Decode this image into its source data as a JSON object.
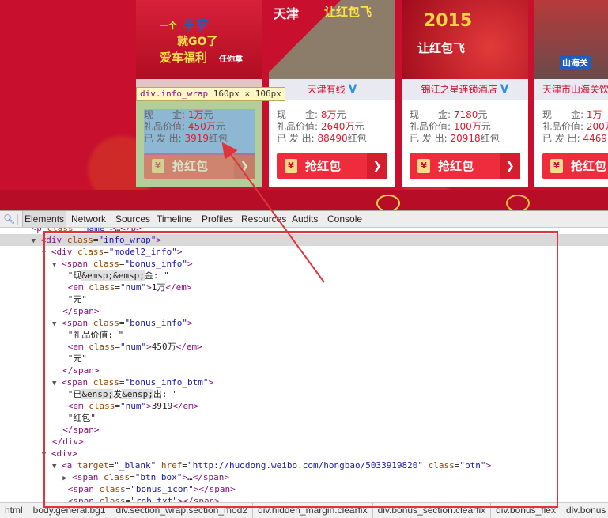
{
  "cards": [
    {
      "id": "card1",
      "banner_lines": [
        "一个",
        "车享",
        "就GO了",
        "爱车福利",
        "任你拿"
      ],
      "name": "",
      "verified": false,
      "rows": [
        {
          "label": "现　　金: ",
          "num": "1万",
          "unit": "元"
        },
        {
          "label": "礼品价值: ",
          "num": "450万",
          "unit": "元"
        },
        {
          "label": "已 发 出: ",
          "num": "3919",
          "unit": "红包"
        }
      ],
      "button": "抢红包"
    },
    {
      "id": "card2",
      "banner_lines": [
        "天津",
        "让红包飞"
      ],
      "name": "天津有线",
      "verified": true,
      "rows": [
        {
          "label": "现　　金: ",
          "num": "8万",
          "unit": "元"
        },
        {
          "label": "礼品价值: ",
          "num": "2640万",
          "unit": "元"
        },
        {
          "label": "已 发 出: ",
          "num": "88490",
          "unit": "红包"
        }
      ],
      "button": "抢红包"
    },
    {
      "id": "card3",
      "banner_lines": [
        "2015",
        "让红包飞"
      ],
      "name": "锦江之星连锁酒店",
      "verified": true,
      "rows": [
        {
          "label": "现　　金: ",
          "num": "7180",
          "unit": "元"
        },
        {
          "label": "礼品价值: ",
          "num": "100万",
          "unit": "元"
        },
        {
          "label": "已 发 出: ",
          "num": "20918",
          "unit": "红包"
        }
      ],
      "button": "抢红包"
    },
    {
      "id": "card4",
      "banner_lines": [
        "山海关"
      ],
      "name": "天津市山海关饮",
      "verified": false,
      "rows": [
        {
          "label": "现　　金: ",
          "num": "1万",
          "unit": ""
        },
        {
          "label": "礼品价值: ",
          "num": "200万",
          "unit": ""
        },
        {
          "label": "已 发 出: ",
          "num": "4469",
          "unit": ""
        }
      ],
      "button": "抢红包"
    }
  ],
  "tooltip": {
    "name": "div.info_wrap",
    "dims": "160px × 106px"
  },
  "devtools": {
    "tabs": [
      "Elements",
      "Network",
      "Sources",
      "Timeline",
      "Profiles",
      "Resources",
      "Audits",
      "Console"
    ],
    "active_tab": "Elements",
    "code_lines": [
      {
        "indent": 6,
        "tri": "",
        "html": "<span class=\"t-tag\">&lt;p</span> <span class=\"t-attr\">class</span>=<span class=\"t-val\">\"name\"</span><span class=\"t-tag\">&gt;</span>…<span class=\"t-tag\">&lt;/p&gt;</span>",
        "clip": true
      },
      {
        "indent": 6,
        "tri": "▼",
        "html": "<span class=\"t-tag\">&lt;div</span> <span class=\"t-attr\">class</span>=<span class=\"t-val\">\"info_wrap\"</span><span class=\"t-tag\">&gt;</span>",
        "selected": true
      },
      {
        "indent": 8,
        "tri": "▼",
        "html": "<span class=\"t-tag\">&lt;div</span> <span class=\"t-attr\">class</span>=<span class=\"t-val\">\"model2_info\"</span><span class=\"t-tag\">&gt;</span>"
      },
      {
        "indent": 10,
        "tri": "▼",
        "html": "<span class=\"t-tag\">&lt;span</span> <span class=\"t-attr\">class</span>=<span class=\"t-val\">\"bonus_info\"</span><span class=\"t-tag\">&gt;</span>"
      },
      {
        "indent": 13,
        "tri": "",
        "html": "\"现<span class=\"t-ent\">&amp;emsp;&amp;emsp;</span>金: \""
      },
      {
        "indent": 13,
        "tri": "",
        "html": "<span class=\"t-tag\">&lt;em</span> <span class=\"t-attr\">class</span>=<span class=\"t-val\">\"num\"</span><span class=\"t-tag\">&gt;</span>1万<span class=\"t-tag\">&lt;/em&gt;</span>"
      },
      {
        "indent": 13,
        "tri": "",
        "html": "\"元\""
      },
      {
        "indent": 12,
        "tri": "",
        "html": "<span class=\"t-tag\">&lt;/span&gt;</span>"
      },
      {
        "indent": 10,
        "tri": "▼",
        "html": "<span class=\"t-tag\">&lt;span</span> <span class=\"t-attr\">class</span>=<span class=\"t-val\">\"bonus_info\"</span><span class=\"t-tag\">&gt;</span>"
      },
      {
        "indent": 13,
        "tri": "",
        "html": "\"礼品价值: \""
      },
      {
        "indent": 13,
        "tri": "",
        "html": "<span class=\"t-tag\">&lt;em</span> <span class=\"t-attr\">class</span>=<span class=\"t-val\">\"num\"</span><span class=\"t-tag\">&gt;</span>450万<span class=\"t-tag\">&lt;/em&gt;</span>"
      },
      {
        "indent": 13,
        "tri": "",
        "html": "\"元\""
      },
      {
        "indent": 12,
        "tri": "",
        "html": "<span class=\"t-tag\">&lt;/span&gt;</span>"
      },
      {
        "indent": 10,
        "tri": "▼",
        "html": "<span class=\"t-tag\">&lt;span</span> <span class=\"t-attr\">class</span>=<span class=\"t-val\">\"bonus_info_btm\"</span><span class=\"t-tag\">&gt;</span>"
      },
      {
        "indent": 13,
        "tri": "",
        "html": "\"已<span class=\"t-ent\">&amp;ensp;</span>发<span class=\"t-ent\">&amp;ensp;</span>出: \""
      },
      {
        "indent": 13,
        "tri": "",
        "html": "<span class=\"t-tag\">&lt;em</span> <span class=\"t-attr\">class</span>=<span class=\"t-val\">\"num\"</span><span class=\"t-tag\">&gt;</span>3919<span class=\"t-tag\">&lt;/em&gt;</span>"
      },
      {
        "indent": 13,
        "tri": "",
        "html": "\"红包\""
      },
      {
        "indent": 12,
        "tri": "",
        "html": "<span class=\"t-tag\">&lt;/span&gt;</span>"
      },
      {
        "indent": 10,
        "tri": "",
        "html": "<span class=\"t-tag\">&lt;/div&gt;</span>"
      },
      {
        "indent": 8,
        "tri": "▼",
        "html": "<span class=\"t-tag\">&lt;div&gt;</span>"
      },
      {
        "indent": 10,
        "tri": "▼",
        "html": "<span class=\"t-tag\">&lt;a</span> <span class=\"t-attr\">target</span>=<span class=\"t-val\">\"_blank\"</span> <span class=\"t-attr\">href</span>=<span class=\"t-val\">\"http://huodong.weibo.com/hongbao/5033919820\"</span> <span class=\"t-attr\">class</span>=<span class=\"t-val\">\"btn\"</span><span class=\"t-tag\">&gt;</span>"
      },
      {
        "indent": 12,
        "tri": "▶",
        "html": "<span class=\"t-tag\">&lt;span</span> <span class=\"t-attr\">class</span>=<span class=\"t-val\">\"btn_box\"</span><span class=\"t-tag\">&gt;</span>…<span class=\"t-tag\">&lt;/span&gt;</span>"
      },
      {
        "indent": 13,
        "tri": "",
        "html": "<span class=\"t-tag\">&lt;span</span> <span class=\"t-attr\">class</span>=<span class=\"t-val\">\"bonus_icon\"</span><span class=\"t-tag\">&gt;&lt;/span&gt;</span>"
      },
      {
        "indent": 13,
        "tri": "",
        "html": "<span class=\"t-tag\">&lt;span</span> <span class=\"t-attr\">class</span>=<span class=\"t-val\">\"rob_txt\"</span><span class=\"t-tag\">&gt;&lt;/span&gt;</span>"
      }
    ],
    "breadcrumbs": [
      "html",
      "body.general.bg1",
      "div.section_wrap.section_mod2",
      "div.hidden_margin.clearfix",
      "div.bonus_section.clearfix",
      "div.bonus_flex",
      "div.bonus"
    ]
  },
  "colors": {
    "page_red": "#c8102e",
    "highlight_box": "#e0343a",
    "button_red": "#ee2c3c"
  }
}
